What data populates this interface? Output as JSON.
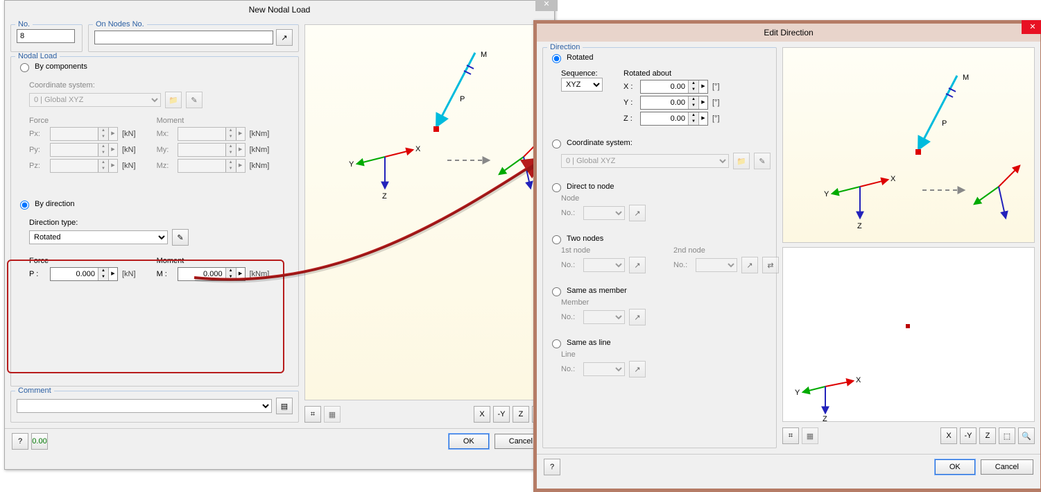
{
  "dialog1": {
    "title": "New Nodal Load",
    "no_label": "No.",
    "no_value": "8",
    "on_nodes_label": "On Nodes No.",
    "on_nodes_value": "",
    "nodal_load_label": "Nodal Load",
    "by_components": "By components",
    "coord_sys_label": "Coordinate system:",
    "coord_sys_value": "0 | Global XYZ",
    "force_label": "Force",
    "moment_label": "Moment",
    "Px": "Px:",
    "Py": "Py:",
    "Pz": "Pz:",
    "Mx": "Mx:",
    "My": "My:",
    "Mz": "Mz:",
    "unit_kN": "[kN]",
    "unit_kNm": "[kNm]",
    "by_direction": "By direction",
    "direction_type_label": "Direction type:",
    "direction_type_value": "Rotated",
    "force2": "Force",
    "moment2": "Moment",
    "P_label": "P :",
    "M_label": "M :",
    "P_value": "0.000",
    "M_value": "0.000",
    "comment_label": "Comment",
    "ok": "OK",
    "cancel": "Cancel"
  },
  "dialog2": {
    "title": "Edit Direction",
    "direction_label": "Direction",
    "rotated": "Rotated",
    "sequence_label": "Sequence:",
    "sequence_value": "XYZ",
    "rotated_about": "Rotated about",
    "X": "X :",
    "Y": "Y :",
    "Z": "Z :",
    "angle_value": "0.00",
    "deg": "[°]",
    "coord_sys": "Coordinate system:",
    "coord_sys_value": "0 | Global XYZ",
    "direct_to_node": "Direct to node",
    "node": "Node",
    "no": "No.:",
    "two_nodes": "Two nodes",
    "first_node": "1st node",
    "second_node": "2nd node",
    "same_member": "Same as member",
    "member": "Member",
    "same_line": "Same as line",
    "line": "Line",
    "ok": "OK",
    "cancel": "Cancel"
  },
  "preview": {
    "X": "X",
    "Y": "Y",
    "Z": "Z",
    "P": "P",
    "M": "M"
  }
}
